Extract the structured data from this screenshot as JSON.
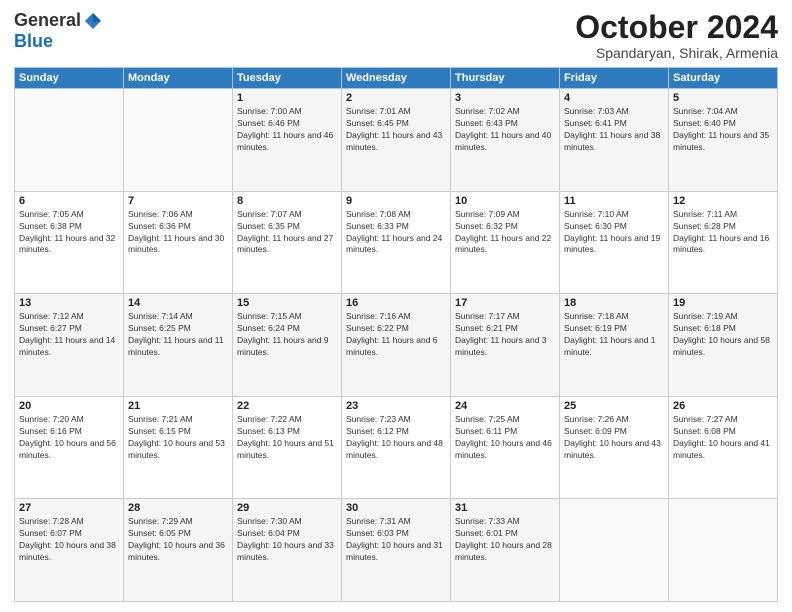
{
  "logo": {
    "general": "General",
    "blue": "Blue"
  },
  "header": {
    "month": "October 2024",
    "location": "Spandaryan, Shirak, Armenia"
  },
  "weekdays": [
    "Sunday",
    "Monday",
    "Tuesday",
    "Wednesday",
    "Thursday",
    "Friday",
    "Saturday"
  ],
  "weeks": [
    [
      {
        "day": "",
        "sunrise": "",
        "sunset": "",
        "daylight": ""
      },
      {
        "day": "",
        "sunrise": "",
        "sunset": "",
        "daylight": ""
      },
      {
        "day": "1",
        "sunrise": "Sunrise: 7:00 AM",
        "sunset": "Sunset: 6:46 PM",
        "daylight": "Daylight: 11 hours and 46 minutes."
      },
      {
        "day": "2",
        "sunrise": "Sunrise: 7:01 AM",
        "sunset": "Sunset: 6:45 PM",
        "daylight": "Daylight: 11 hours and 43 minutes."
      },
      {
        "day": "3",
        "sunrise": "Sunrise: 7:02 AM",
        "sunset": "Sunset: 6:43 PM",
        "daylight": "Daylight: 11 hours and 40 minutes."
      },
      {
        "day": "4",
        "sunrise": "Sunrise: 7:03 AM",
        "sunset": "Sunset: 6:41 PM",
        "daylight": "Daylight: 11 hours and 38 minutes."
      },
      {
        "day": "5",
        "sunrise": "Sunrise: 7:04 AM",
        "sunset": "Sunset: 6:40 PM",
        "daylight": "Daylight: 11 hours and 35 minutes."
      }
    ],
    [
      {
        "day": "6",
        "sunrise": "Sunrise: 7:05 AM",
        "sunset": "Sunset: 6:38 PM",
        "daylight": "Daylight: 11 hours and 32 minutes."
      },
      {
        "day": "7",
        "sunrise": "Sunrise: 7:06 AM",
        "sunset": "Sunset: 6:36 PM",
        "daylight": "Daylight: 11 hours and 30 minutes."
      },
      {
        "day": "8",
        "sunrise": "Sunrise: 7:07 AM",
        "sunset": "Sunset: 6:35 PM",
        "daylight": "Daylight: 11 hours and 27 minutes."
      },
      {
        "day": "9",
        "sunrise": "Sunrise: 7:08 AM",
        "sunset": "Sunset: 6:33 PM",
        "daylight": "Daylight: 11 hours and 24 minutes."
      },
      {
        "day": "10",
        "sunrise": "Sunrise: 7:09 AM",
        "sunset": "Sunset: 6:32 PM",
        "daylight": "Daylight: 11 hours and 22 minutes."
      },
      {
        "day": "11",
        "sunrise": "Sunrise: 7:10 AM",
        "sunset": "Sunset: 6:30 PM",
        "daylight": "Daylight: 11 hours and 19 minutes."
      },
      {
        "day": "12",
        "sunrise": "Sunrise: 7:11 AM",
        "sunset": "Sunset: 6:28 PM",
        "daylight": "Daylight: 11 hours and 16 minutes."
      }
    ],
    [
      {
        "day": "13",
        "sunrise": "Sunrise: 7:12 AM",
        "sunset": "Sunset: 6:27 PM",
        "daylight": "Daylight: 11 hours and 14 minutes."
      },
      {
        "day": "14",
        "sunrise": "Sunrise: 7:14 AM",
        "sunset": "Sunset: 6:25 PM",
        "daylight": "Daylight: 11 hours and 11 minutes."
      },
      {
        "day": "15",
        "sunrise": "Sunrise: 7:15 AM",
        "sunset": "Sunset: 6:24 PM",
        "daylight": "Daylight: 11 hours and 9 minutes."
      },
      {
        "day": "16",
        "sunrise": "Sunrise: 7:16 AM",
        "sunset": "Sunset: 6:22 PM",
        "daylight": "Daylight: 11 hours and 6 minutes."
      },
      {
        "day": "17",
        "sunrise": "Sunrise: 7:17 AM",
        "sunset": "Sunset: 6:21 PM",
        "daylight": "Daylight: 11 hours and 3 minutes."
      },
      {
        "day": "18",
        "sunrise": "Sunrise: 7:18 AM",
        "sunset": "Sunset: 6:19 PM",
        "daylight": "Daylight: 11 hours and 1 minute."
      },
      {
        "day": "19",
        "sunrise": "Sunrise: 7:19 AM",
        "sunset": "Sunset: 6:18 PM",
        "daylight": "Daylight: 10 hours and 58 minutes."
      }
    ],
    [
      {
        "day": "20",
        "sunrise": "Sunrise: 7:20 AM",
        "sunset": "Sunset: 6:16 PM",
        "daylight": "Daylight: 10 hours and 56 minutes."
      },
      {
        "day": "21",
        "sunrise": "Sunrise: 7:21 AM",
        "sunset": "Sunset: 6:15 PM",
        "daylight": "Daylight: 10 hours and 53 minutes."
      },
      {
        "day": "22",
        "sunrise": "Sunrise: 7:22 AM",
        "sunset": "Sunset: 6:13 PM",
        "daylight": "Daylight: 10 hours and 51 minutes."
      },
      {
        "day": "23",
        "sunrise": "Sunrise: 7:23 AM",
        "sunset": "Sunset: 6:12 PM",
        "daylight": "Daylight: 10 hours and 48 minutes."
      },
      {
        "day": "24",
        "sunrise": "Sunrise: 7:25 AM",
        "sunset": "Sunset: 6:11 PM",
        "daylight": "Daylight: 10 hours and 46 minutes."
      },
      {
        "day": "25",
        "sunrise": "Sunrise: 7:26 AM",
        "sunset": "Sunset: 6:09 PM",
        "daylight": "Daylight: 10 hours and 43 minutes."
      },
      {
        "day": "26",
        "sunrise": "Sunrise: 7:27 AM",
        "sunset": "Sunset: 6:08 PM",
        "daylight": "Daylight: 10 hours and 41 minutes."
      }
    ],
    [
      {
        "day": "27",
        "sunrise": "Sunrise: 7:28 AM",
        "sunset": "Sunset: 6:07 PM",
        "daylight": "Daylight: 10 hours and 38 minutes."
      },
      {
        "day": "28",
        "sunrise": "Sunrise: 7:29 AM",
        "sunset": "Sunset: 6:05 PM",
        "daylight": "Daylight: 10 hours and 36 minutes."
      },
      {
        "day": "29",
        "sunrise": "Sunrise: 7:30 AM",
        "sunset": "Sunset: 6:04 PM",
        "daylight": "Daylight: 10 hours and 33 minutes."
      },
      {
        "day": "30",
        "sunrise": "Sunrise: 7:31 AM",
        "sunset": "Sunset: 6:03 PM",
        "daylight": "Daylight: 10 hours and 31 minutes."
      },
      {
        "day": "31",
        "sunrise": "Sunrise: 7:33 AM",
        "sunset": "Sunset: 6:01 PM",
        "daylight": "Daylight: 10 hours and 28 minutes."
      },
      {
        "day": "",
        "sunrise": "",
        "sunset": "",
        "daylight": ""
      },
      {
        "day": "",
        "sunrise": "",
        "sunset": "",
        "daylight": ""
      }
    ]
  ]
}
